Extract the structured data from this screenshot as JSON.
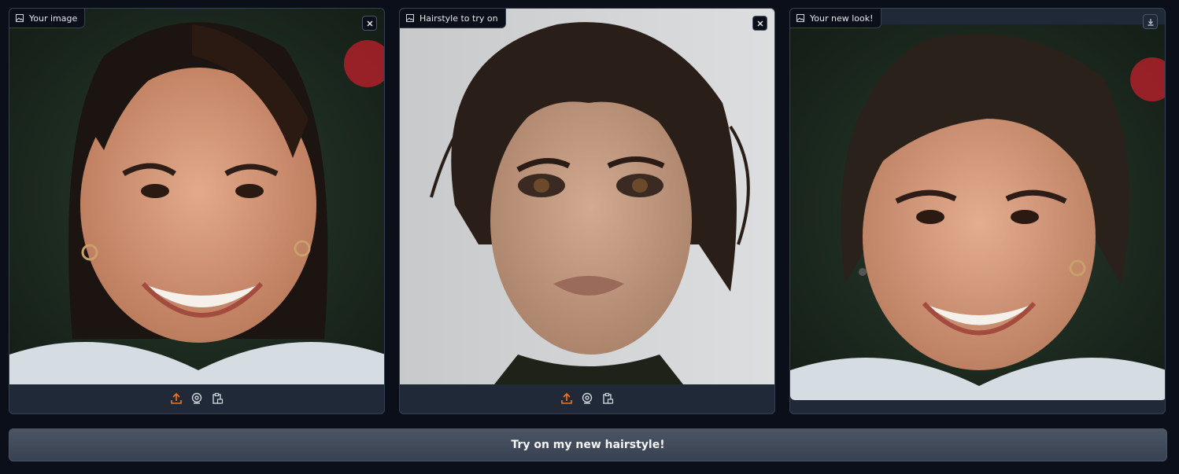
{
  "panels": [
    {
      "label": "Your image",
      "label_icon": "image-icon",
      "corner_icon": "close-icon"
    },
    {
      "label": "Hairstyle to try on",
      "label_icon": "image-icon",
      "corner_icon": "close-icon"
    },
    {
      "label": "Your new look!",
      "label_icon": "image-icon",
      "corner_icon": "download-icon"
    }
  ],
  "toolbar_icons": [
    "upload-icon",
    "webcam-icon",
    "clipboard-icon"
  ],
  "colors": {
    "accent": "#f97316",
    "background": "#0b0f19",
    "panel": "#1f2937",
    "border": "#374151"
  },
  "submit_button": {
    "label": "Try on my new hairstyle!"
  }
}
